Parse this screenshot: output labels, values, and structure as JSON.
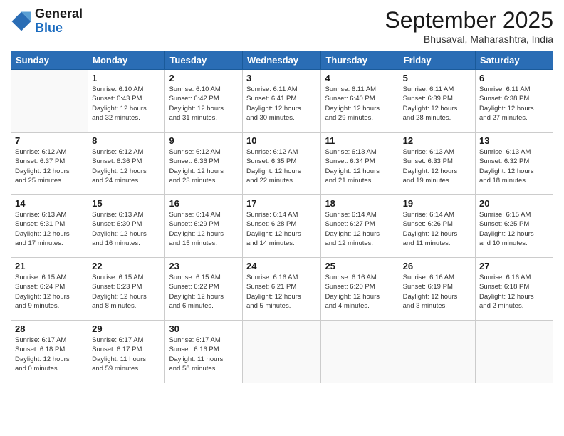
{
  "logo": {
    "line1": "General",
    "line2": "Blue"
  },
  "title": "September 2025",
  "subtitle": "Bhusaval, Maharashtra, India",
  "header_days": [
    "Sunday",
    "Monday",
    "Tuesday",
    "Wednesday",
    "Thursday",
    "Friday",
    "Saturday"
  ],
  "weeks": [
    [
      {
        "day": "",
        "info": ""
      },
      {
        "day": "1",
        "info": "Sunrise: 6:10 AM\nSunset: 6:43 PM\nDaylight: 12 hours\nand 32 minutes."
      },
      {
        "day": "2",
        "info": "Sunrise: 6:10 AM\nSunset: 6:42 PM\nDaylight: 12 hours\nand 31 minutes."
      },
      {
        "day": "3",
        "info": "Sunrise: 6:11 AM\nSunset: 6:41 PM\nDaylight: 12 hours\nand 30 minutes."
      },
      {
        "day": "4",
        "info": "Sunrise: 6:11 AM\nSunset: 6:40 PM\nDaylight: 12 hours\nand 29 minutes."
      },
      {
        "day": "5",
        "info": "Sunrise: 6:11 AM\nSunset: 6:39 PM\nDaylight: 12 hours\nand 28 minutes."
      },
      {
        "day": "6",
        "info": "Sunrise: 6:11 AM\nSunset: 6:38 PM\nDaylight: 12 hours\nand 27 minutes."
      }
    ],
    [
      {
        "day": "7",
        "info": "Sunrise: 6:12 AM\nSunset: 6:37 PM\nDaylight: 12 hours\nand 25 minutes."
      },
      {
        "day": "8",
        "info": "Sunrise: 6:12 AM\nSunset: 6:36 PM\nDaylight: 12 hours\nand 24 minutes."
      },
      {
        "day": "9",
        "info": "Sunrise: 6:12 AM\nSunset: 6:36 PM\nDaylight: 12 hours\nand 23 minutes."
      },
      {
        "day": "10",
        "info": "Sunrise: 6:12 AM\nSunset: 6:35 PM\nDaylight: 12 hours\nand 22 minutes."
      },
      {
        "day": "11",
        "info": "Sunrise: 6:13 AM\nSunset: 6:34 PM\nDaylight: 12 hours\nand 21 minutes."
      },
      {
        "day": "12",
        "info": "Sunrise: 6:13 AM\nSunset: 6:33 PM\nDaylight: 12 hours\nand 19 minutes."
      },
      {
        "day": "13",
        "info": "Sunrise: 6:13 AM\nSunset: 6:32 PM\nDaylight: 12 hours\nand 18 minutes."
      }
    ],
    [
      {
        "day": "14",
        "info": "Sunrise: 6:13 AM\nSunset: 6:31 PM\nDaylight: 12 hours\nand 17 minutes."
      },
      {
        "day": "15",
        "info": "Sunrise: 6:13 AM\nSunset: 6:30 PM\nDaylight: 12 hours\nand 16 minutes."
      },
      {
        "day": "16",
        "info": "Sunrise: 6:14 AM\nSunset: 6:29 PM\nDaylight: 12 hours\nand 15 minutes."
      },
      {
        "day": "17",
        "info": "Sunrise: 6:14 AM\nSunset: 6:28 PM\nDaylight: 12 hours\nand 14 minutes."
      },
      {
        "day": "18",
        "info": "Sunrise: 6:14 AM\nSunset: 6:27 PM\nDaylight: 12 hours\nand 12 minutes."
      },
      {
        "day": "19",
        "info": "Sunrise: 6:14 AM\nSunset: 6:26 PM\nDaylight: 12 hours\nand 11 minutes."
      },
      {
        "day": "20",
        "info": "Sunrise: 6:15 AM\nSunset: 6:25 PM\nDaylight: 12 hours\nand 10 minutes."
      }
    ],
    [
      {
        "day": "21",
        "info": "Sunrise: 6:15 AM\nSunset: 6:24 PM\nDaylight: 12 hours\nand 9 minutes."
      },
      {
        "day": "22",
        "info": "Sunrise: 6:15 AM\nSunset: 6:23 PM\nDaylight: 12 hours\nand 8 minutes."
      },
      {
        "day": "23",
        "info": "Sunrise: 6:15 AM\nSunset: 6:22 PM\nDaylight: 12 hours\nand 6 minutes."
      },
      {
        "day": "24",
        "info": "Sunrise: 6:16 AM\nSunset: 6:21 PM\nDaylight: 12 hours\nand 5 minutes."
      },
      {
        "day": "25",
        "info": "Sunrise: 6:16 AM\nSunset: 6:20 PM\nDaylight: 12 hours\nand 4 minutes."
      },
      {
        "day": "26",
        "info": "Sunrise: 6:16 AM\nSunset: 6:19 PM\nDaylight: 12 hours\nand 3 minutes."
      },
      {
        "day": "27",
        "info": "Sunrise: 6:16 AM\nSunset: 6:18 PM\nDaylight: 12 hours\nand 2 minutes."
      }
    ],
    [
      {
        "day": "28",
        "info": "Sunrise: 6:17 AM\nSunset: 6:18 PM\nDaylight: 12 hours\nand 0 minutes."
      },
      {
        "day": "29",
        "info": "Sunrise: 6:17 AM\nSunset: 6:17 PM\nDaylight: 11 hours\nand 59 minutes."
      },
      {
        "day": "30",
        "info": "Sunrise: 6:17 AM\nSunset: 6:16 PM\nDaylight: 11 hours\nand 58 minutes."
      },
      {
        "day": "",
        "info": ""
      },
      {
        "day": "",
        "info": ""
      },
      {
        "day": "",
        "info": ""
      },
      {
        "day": "",
        "info": ""
      }
    ]
  ]
}
